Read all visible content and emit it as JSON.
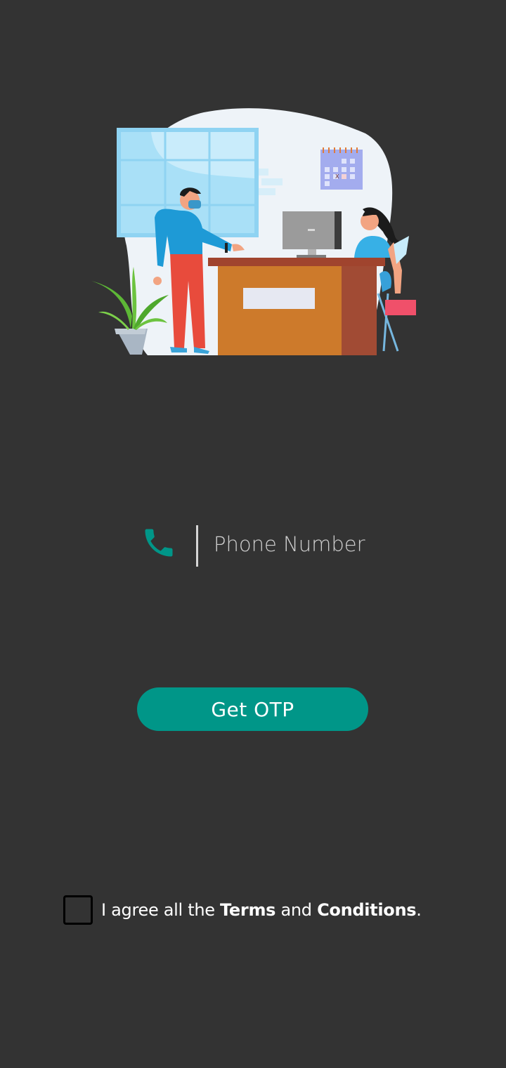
{
  "illustration": {
    "description_icon": "reception-desk-illustration",
    "calendar_mark": "X"
  },
  "phone": {
    "icon": "phone-icon",
    "placeholder": "Phone Number",
    "value": ""
  },
  "otp_button": {
    "label": "Get OTP"
  },
  "terms": {
    "prefix": "I agree all the ",
    "terms_word": "Terms",
    "connector": " and ",
    "conditions_word": "Conditions",
    "suffix": ".",
    "checked": false
  },
  "colors": {
    "background": "#333333",
    "accent": "#009688",
    "text": "#ffffff"
  }
}
